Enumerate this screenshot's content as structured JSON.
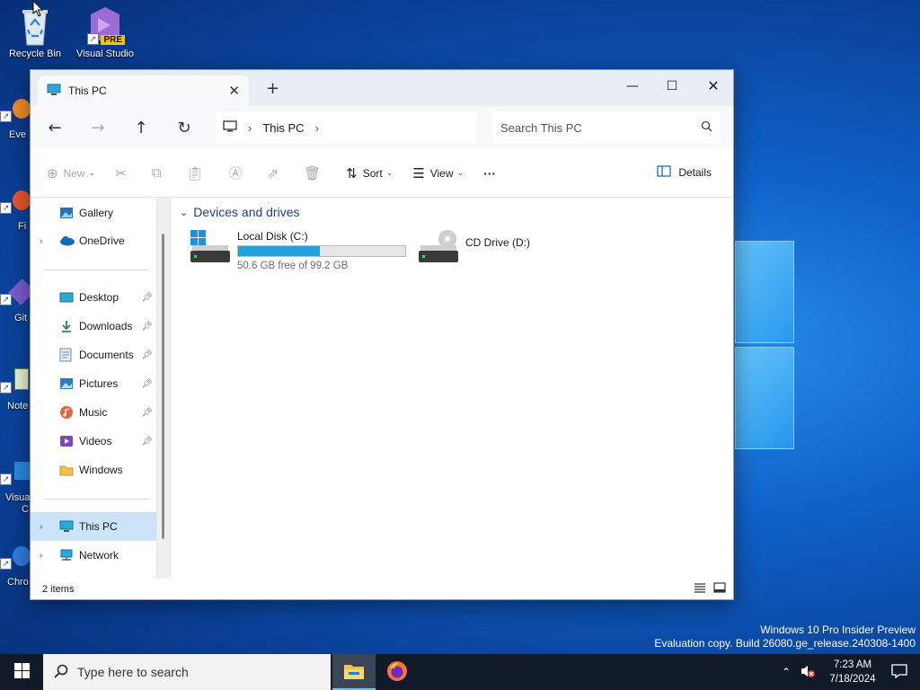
{
  "desktop": {
    "icons": [
      {
        "label": "Recycle Bin"
      },
      {
        "label": "Visual Studio",
        "badge": "PRE"
      }
    ],
    "partial_icons": [
      {
        "label": "Eve"
      },
      {
        "label": "Fi"
      },
      {
        "label": "Git"
      },
      {
        "label": "Note"
      },
      {
        "label": "Visua"
      },
      {
        "label": "C"
      },
      {
        "label": "Chro"
      }
    ],
    "watermark": {
      "line1": "Windows 10 Pro Insider Preview",
      "line2": "Evaluation copy. Build 26080.ge_release.240308-1400"
    }
  },
  "explorer": {
    "tab_title": "This PC",
    "new_tab_symbol": "+",
    "address": {
      "location": "This PC"
    },
    "search": {
      "placeholder": "Search This PC"
    },
    "commands": {
      "new": "New",
      "sort": "Sort",
      "view": "View",
      "more": "···",
      "details": "Details"
    },
    "nav": {
      "gallery": "Gallery",
      "onedrive": "OneDrive",
      "desktop": "Desktop",
      "downloads": "Downloads",
      "documents": "Documents",
      "pictures": "Pictures",
      "music": "Music",
      "videos": "Videos",
      "windows": "Windows",
      "thispc": "This PC",
      "network": "Network"
    },
    "group_header": "Devices and drives",
    "drives": [
      {
        "name": "Local Disk (C:)",
        "free_text": "50.6 GB free of 99.2 GB",
        "used_fraction": 0.49
      },
      {
        "name": "CD Drive (D:)"
      }
    ],
    "status": "2 items"
  },
  "taskbar": {
    "search_placeholder": "Type here to search",
    "time": "7:23 AM",
    "date": "7/18/2024"
  },
  "colors": {
    "accent": "#26a0da",
    "selection": "#cce4f7",
    "taskbar": "#101a28"
  }
}
